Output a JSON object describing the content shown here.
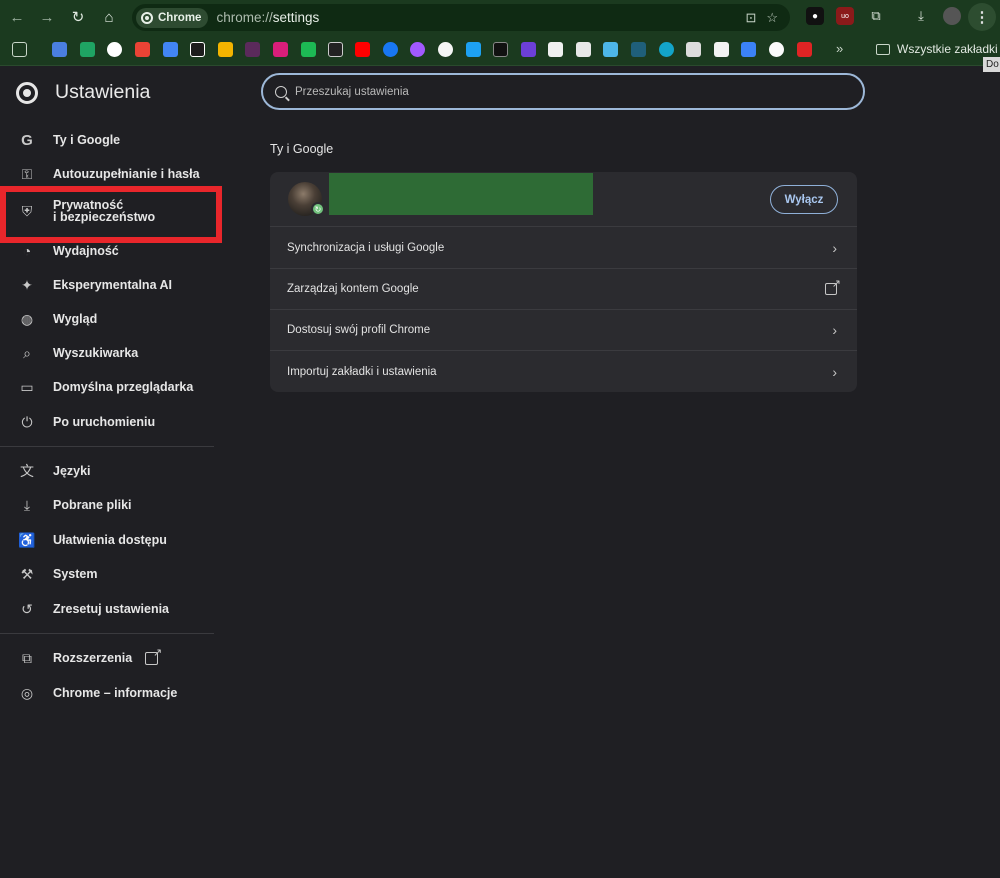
{
  "browser": {
    "chip_label": "Chrome",
    "url_scheme": "chrome://",
    "url_path": "settings",
    "bookmarks_folder_label": "Wszystkie zakładki",
    "tooltip_text": "Do"
  },
  "settings": {
    "title": "Ustawienia",
    "search_placeholder": "Przeszukaj ustawienia",
    "sidebar": {
      "group1": [
        {
          "label": "Ty i Google",
          "icon": "google-g-icon"
        },
        {
          "label": "Autouzupełnianie i hasła",
          "icon": "key-icon"
        },
        {
          "label": "Prywatność\ni bezpieczeństwo",
          "icon": "shield-icon"
        },
        {
          "label": "Wydajność",
          "icon": "speedometer-icon"
        },
        {
          "label": "Eksperymentalna AI",
          "icon": "sparkle-icon"
        },
        {
          "label": "Wygląd",
          "icon": "palette-icon"
        },
        {
          "label": "Wyszukiwarka",
          "icon": "search-icon"
        },
        {
          "label": "Domyślna przeglądarka",
          "icon": "browser-window-icon"
        },
        {
          "label": "Po uruchomieniu",
          "icon": "power-icon"
        }
      ],
      "group2": [
        {
          "label": "Języki",
          "icon": "translate-icon"
        },
        {
          "label": "Pobrane pliki",
          "icon": "download-icon"
        },
        {
          "label": "Ułatwienia dostępu",
          "icon": "accessibility-icon"
        },
        {
          "label": "System",
          "icon": "wrench-icon"
        },
        {
          "label": "Zresetuj ustawienia",
          "icon": "reset-icon"
        }
      ],
      "group3": [
        {
          "label": "Rozszerzenia",
          "icon": "puzzle-icon"
        },
        {
          "label": "Chrome – informacje",
          "icon": "chrome-logo-icon"
        }
      ]
    },
    "section_title": "Ty i Google",
    "off_button_label": "Wyłącz",
    "rows": [
      {
        "label": "Synchronizacja i usługi Google",
        "trailing": "chevron"
      },
      {
        "label": "Zarządzaj kontem Google",
        "trailing": "external"
      },
      {
        "label": "Dostosuj swój profil Chrome",
        "trailing": "chevron"
      },
      {
        "label": "Importuj zakładki i ustawienia",
        "trailing": "chevron"
      }
    ]
  },
  "colors": {
    "browser_frame": "#1b3a1f",
    "page_background": "#1f1f23",
    "card_background": "#2b2b2f",
    "accent_blue": "#a9c7ef",
    "highlight_red": "#e8262b",
    "redaction_green": "#2e6b35"
  }
}
